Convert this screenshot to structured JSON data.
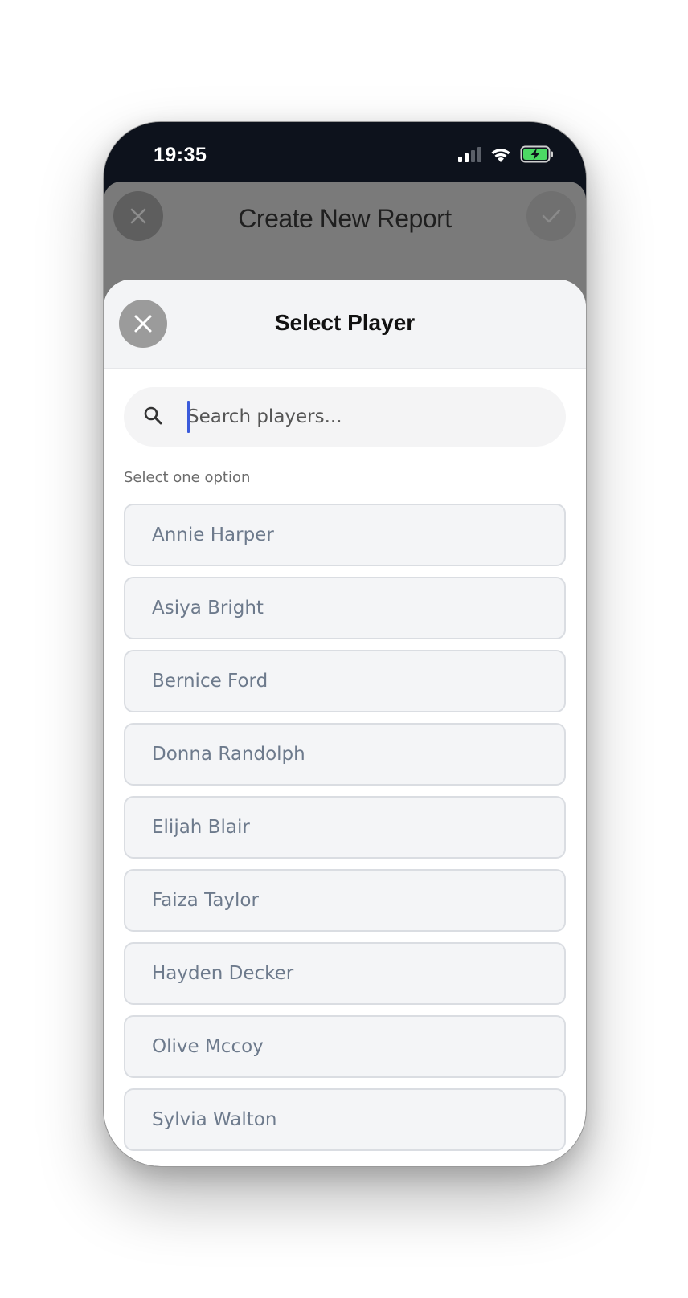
{
  "status_bar": {
    "time": "19:35",
    "icons": [
      "signal-icon",
      "wifi-icon",
      "battery-charging-icon"
    ]
  },
  "background_screen": {
    "title": "Create New Report",
    "close_icon": "close-icon",
    "confirm_icon": "check-icon"
  },
  "sheet": {
    "title": "Select Player",
    "close_icon": "close-icon",
    "search": {
      "placeholder": "Search players...",
      "value": "",
      "icon": "search-icon"
    },
    "helper_text": "Select one option",
    "players": [
      {
        "label": "Annie Harper"
      },
      {
        "label": "Asiya Bright"
      },
      {
        "label": "Bernice Ford"
      },
      {
        "label": "Donna Randolph"
      },
      {
        "label": "Elijah Blair"
      },
      {
        "label": "Faiza Taylor"
      },
      {
        "label": "Hayden Decker"
      },
      {
        "label": "Olive Mccoy"
      },
      {
        "label": "Sylvia Walton"
      }
    ]
  },
  "colors": {
    "accent_caret": "#3b5bdb",
    "status_bar_bg": "#0d121c",
    "battery_green": "#4cd964"
  }
}
